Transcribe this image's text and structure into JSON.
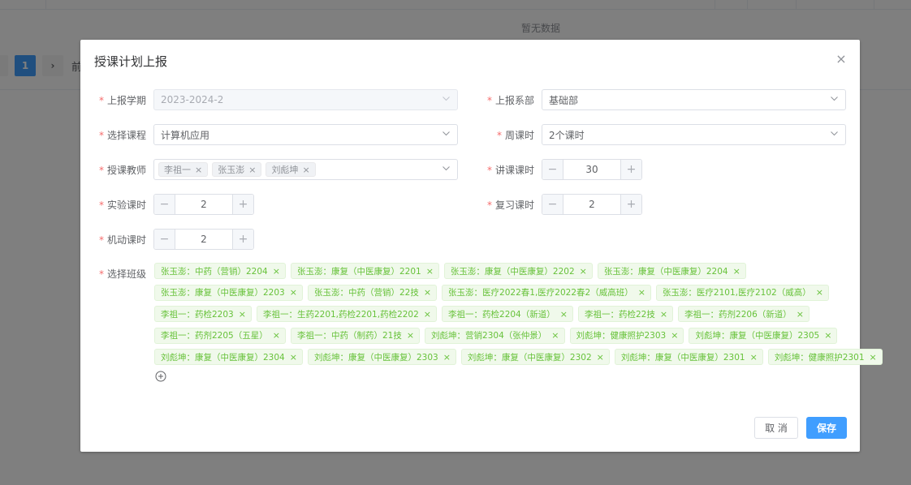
{
  "background": {
    "empty_text": "暂无数据",
    "pager_current": "1",
    "pager_next_glyph": "›",
    "pager_text_fragment": "前"
  },
  "dialog": {
    "title": "授课计划上报",
    "close_glyph": "×"
  },
  "form": {
    "term": {
      "label": "上报学期",
      "value": "2023-2024-2"
    },
    "department": {
      "label": "上报系部",
      "value": "基础部"
    },
    "course": {
      "label": "选择课程",
      "value": "计算机应用"
    },
    "weekly_hours": {
      "label": "周课时",
      "value": "2个课时"
    },
    "teachers": {
      "label": "授课教师",
      "tags": [
        "李祖一",
        "张玉澎",
        "刘彪坤"
      ]
    },
    "lecture_hours": {
      "label": "讲课课时",
      "value": "30"
    },
    "lab_hours": {
      "label": "实验课时",
      "value": "2"
    },
    "review_hours": {
      "label": "复习课时",
      "value": "2"
    },
    "flex_hours": {
      "label": "机动课时",
      "value": "2"
    },
    "classes": {
      "label": "选择班级",
      "rows": [
        [
          "张玉澎：中药（营销）2204",
          "张玉澎：康复（中医康复）2201",
          "张玉澎：康复（中医康复）2202",
          "张玉澎：康复（中医康复）2204"
        ],
        [
          "张玉澎：康复（中医康复）2203",
          "张玉澎：中药（营销）22技",
          "张玉澎：医疗2022春1,医疗2022春2（威高班）",
          "张玉澎：医疗2101,医疗2102（威高）"
        ],
        [
          "李祖一：药检2203",
          "李祖一：生药2201,药检2201,药检2202",
          "李祖一：药检2204（新道）",
          "李祖一：药检22技",
          "李祖一：药剂2206（新道）"
        ],
        [
          "李祖一：药剂2205（五星）",
          "李祖一：中药（制药）21技",
          "刘彪坤：营销2304（张仲景）",
          "刘彪坤：健康照护2303",
          "刘彪坤：康复（中医康复）2305"
        ],
        [
          "刘彪坤：康复（中医康复）2304",
          "刘彪坤：康复（中医康复）2303",
          "刘彪坤：康复（中医康复）2302",
          "刘彪坤：康复（中医康复）2301",
          "刘彪坤：健康照护2301"
        ]
      ]
    },
    "required_mark": "*",
    "minus_glyph": "−",
    "plus_glyph": "+",
    "tag_close_glyph": "×"
  },
  "footer": {
    "cancel_label": "取 消",
    "save_label": "保存"
  }
}
